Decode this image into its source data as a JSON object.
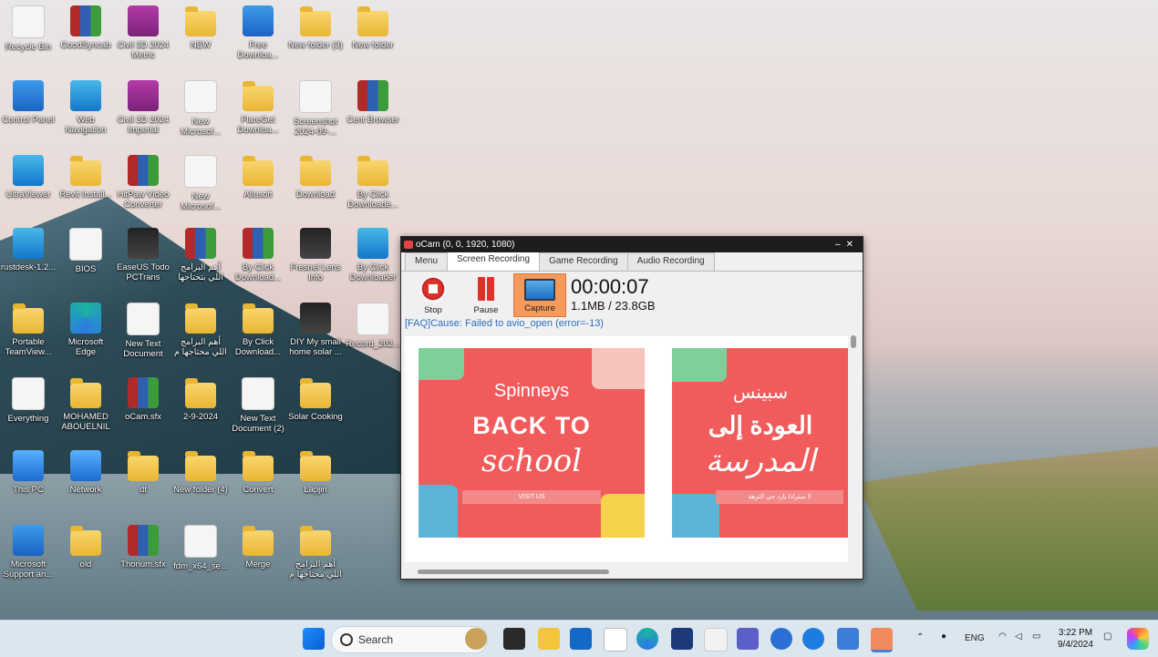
{
  "desktop": {
    "icons": [
      {
        "label": "Recycle Bin"
      },
      {
        "label": "GoodSyncab"
      },
      {
        "label": "Civil 3D 2024 Metric"
      },
      {
        "label": "NEW"
      },
      {
        "label": "Free Downloa..."
      },
      {
        "label": "New folder (3)"
      },
      {
        "label": "New folder"
      },
      {
        "label": "Control Panel"
      },
      {
        "label": "Web Navigation"
      },
      {
        "label": "Civil 3D 2024 Imperial"
      },
      {
        "label": "New Microsof..."
      },
      {
        "label": "FlareGet Downloa..."
      },
      {
        "label": "Screenshot 2024-09-..."
      },
      {
        "label": "Cent Browser"
      },
      {
        "label": "UltraViewer"
      },
      {
        "label": "Revit Install..."
      },
      {
        "label": "HitPaw Video Converter"
      },
      {
        "label": "New Microsof..."
      },
      {
        "label": "Allusoft"
      },
      {
        "label": "Download"
      },
      {
        "label": "By Click Downloade..."
      },
      {
        "label": "rustdesk-1.2..."
      },
      {
        "label": "BIOS"
      },
      {
        "label": "EaseUS Todo PCTrans"
      },
      {
        "label": "أهم البرامج اللي بتحتاجها"
      },
      {
        "label": "By Click Download..."
      },
      {
        "label": "Fresnel Lens Info"
      },
      {
        "label": "By Click Downloader"
      },
      {
        "label": "Portable TeamView..."
      },
      {
        "label": "Microsoft Edge"
      },
      {
        "label": "New Text Document"
      },
      {
        "label": "أهم البرامج اللي محتاجها م"
      },
      {
        "label": "By Click Download..."
      },
      {
        "label": "DIY My small home solar ..."
      },
      {
        "label": "Record_202..."
      },
      {
        "label": "Everything"
      },
      {
        "label": "MOHAMED ABOUELNIL"
      },
      {
        "label": "oCam.sfx"
      },
      {
        "label": "2-9-2024"
      },
      {
        "label": "New Text Document (2)"
      },
      {
        "label": "Solar Cooking"
      },
      {
        "label": "This PC"
      },
      {
        "label": "Network"
      },
      {
        "label": "dt"
      },
      {
        "label": "New folder (4)"
      },
      {
        "label": "Convert"
      },
      {
        "label": "Lapjin"
      },
      {
        "label": "Microsoft Support an..."
      },
      {
        "label": "old"
      },
      {
        "label": "Thorium.sfx"
      },
      {
        "label": "fdm_x64_se..."
      },
      {
        "label": "Merge"
      },
      {
        "label": "أهم البرامج اللي محتاجها م"
      }
    ]
  },
  "ocam": {
    "title": "oCam (0, 0, 1920, 1080)",
    "tabs": [
      "Menu",
      "Screen Recording",
      "Game Recording",
      "Audio Recording"
    ],
    "stop_label": "Stop",
    "pause_label": "Pause",
    "capture_label": "Capture",
    "timer": "00:00:07",
    "size": "1.1MB / 23.8GB",
    "faq": "[FAQ]Cause: Failed to avio_open (error=-13)",
    "banner_en": {
      "brand": "Spinneys",
      "line1": "BACK TO",
      "line2": "school",
      "cta": "VISIT US"
    },
    "banner_ar": {
      "brand": "سبينس",
      "line1": "العودة إلى",
      "line2": "المدرسة",
      "cta": "لا ستراذا يارد حي النزهة"
    }
  },
  "taskbar": {
    "search_placeholder": "Search",
    "lang": "ENG",
    "time": "3:22 PM",
    "date": "9/4/2024"
  },
  "colors": {
    "taskbar": "#dbe6ee",
    "banner": "#f25b5b",
    "capture_active": "#f59a5a",
    "faq_link": "#2c6fc0"
  }
}
